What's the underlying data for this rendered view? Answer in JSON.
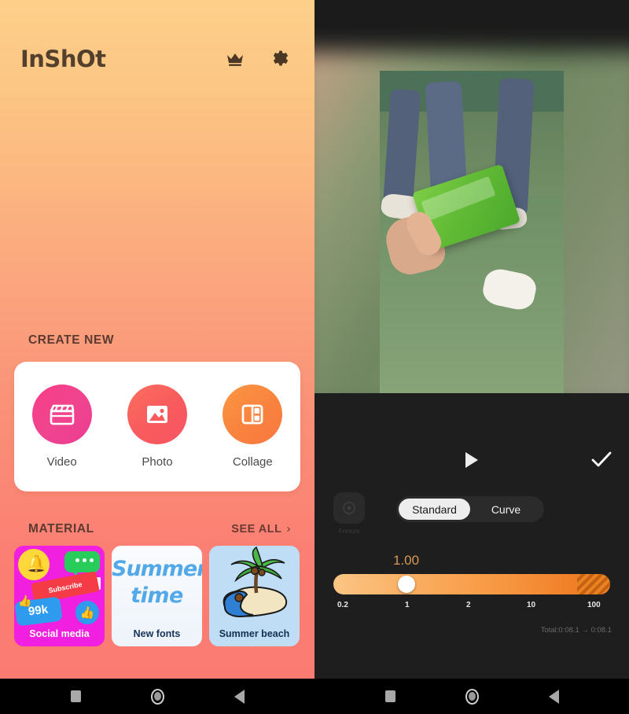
{
  "left_phone": {
    "header": {
      "logo": "InShOt",
      "crown_icon": "crown-icon",
      "gear_icon": "gear-icon"
    },
    "create_new": {
      "title": "CREATE NEW",
      "items": [
        {
          "label": "Video",
          "icon": "clapperboard-icon",
          "color": "#F0458E"
        },
        {
          "label": "Photo",
          "icon": "image-icon",
          "color": "#F85A5D"
        },
        {
          "label": "Collage",
          "icon": "collage-icon",
          "color": "#F9823F"
        }
      ]
    },
    "material": {
      "title": "MATERIAL",
      "see_all": "SEE ALL",
      "chevron": "›",
      "cards": [
        {
          "label": "Social media",
          "badge_text": "Subscribe",
          "count_text": "99k"
        },
        {
          "label": "New fonts",
          "art_line1": "Summer",
          "art_line2": "time"
        },
        {
          "label": "Summer beach"
        }
      ]
    },
    "navbar": {
      "recents": "recents-square",
      "home": "home-circle",
      "back": "back-triangle"
    }
  },
  "right_phone": {
    "preview": {
      "play_icon": "play-icon",
      "confirm_icon": "check-icon"
    },
    "speed_panel": {
      "freeze_label": "Freeze",
      "freeze_icon": "freeze-icon",
      "tabs": [
        {
          "label": "Standard",
          "active": true
        },
        {
          "label": "Curve",
          "active": false
        }
      ],
      "speed_value": "1.00",
      "slider": {
        "ticks": [
          "0.2",
          "1",
          "2",
          "10",
          "100"
        ],
        "min": 0.2,
        "max": 100,
        "current": 1.0,
        "accent": "#F79640",
        "premium_zone_start": 60
      },
      "total_duration": "Total:0:08.1  →  0:08.1"
    },
    "navbar": {
      "recents": "recents-square",
      "home": "home-circle",
      "back": "back-triangle"
    }
  }
}
